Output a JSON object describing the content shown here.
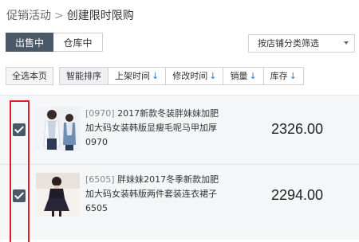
{
  "breadcrumb": {
    "parent": "促销活动",
    "separator": ">",
    "current": "创建限时限购"
  },
  "tabs": [
    {
      "label": "出售中",
      "active": true
    },
    {
      "label": "仓库中",
      "active": false
    }
  ],
  "category_select": {
    "value": "按店铺分类筛选"
  },
  "toolbar": {
    "select_all": "全选本页",
    "sorts": [
      {
        "label": "智能排序",
        "arrow": ""
      },
      {
        "label": "上架时间",
        "arrow": "↓"
      },
      {
        "label": "修改时间",
        "arrow": "↓"
      },
      {
        "label": "销量",
        "arrow": "↓"
      },
      {
        "label": "库存",
        "arrow": "↓"
      }
    ]
  },
  "products": [
    {
      "code": "[0970]",
      "title": "2017新款冬装胖妹妹加肥加大码女装韩版显瘦毛呢马甲加厚0970",
      "price": "2326.00",
      "checked": true
    },
    {
      "code": "[6505]",
      "title": "胖妹妹2017冬季新款加肥加大码女装韩版两件套装连衣裙子6505",
      "price": "2294.00",
      "checked": true
    }
  ],
  "colors": {
    "accent": "#4b5868",
    "highlight": "#e02020",
    "sort_arrow": "#3a7bd5"
  }
}
